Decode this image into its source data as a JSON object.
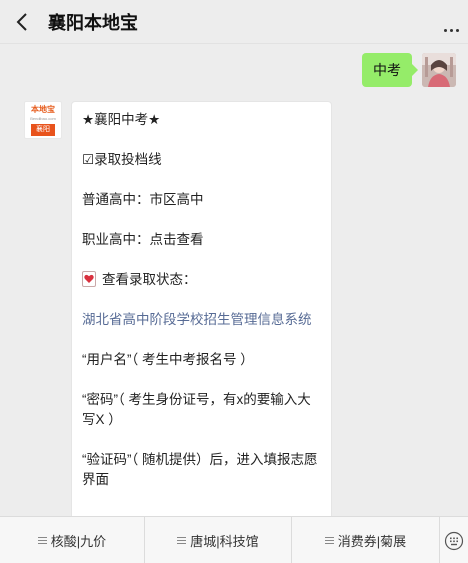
{
  "header": {
    "title": "襄阳本地宝"
  },
  "chat": {
    "outgoing": {
      "text": "中考"
    },
    "incoming": {
      "bot_brand": "本地宝",
      "bot_brand_sub": "Bendibao.com",
      "bot_city": "襄阳",
      "lines": {
        "title": "★襄阳中考★",
        "admission": "☑录取投档线",
        "general_high": "普通高中：市区高中",
        "vocational_high": "职业高中：点击查看",
        "check_status": "查看录取状态：",
        "system_link": "湖北省高中阶段学校招生管理信息系统",
        "username": "“用户名”（ 考生中考报名号 ）",
        "password": "“密码”（ 考生身份证号，有x的要输入大写X ）",
        "captcha": "“验证码”（ 随机提供）后，进入填报志愿界面"
      }
    }
  },
  "bottom_menu": {
    "items": [
      {
        "label": "核酸|九价"
      },
      {
        "label": "唐城|科技馆"
      },
      {
        "label": "消费券|菊展"
      }
    ]
  },
  "colors": {
    "outgoing_bubble": "#95ec69",
    "link": "#576b95",
    "brand": "#e8531c"
  }
}
